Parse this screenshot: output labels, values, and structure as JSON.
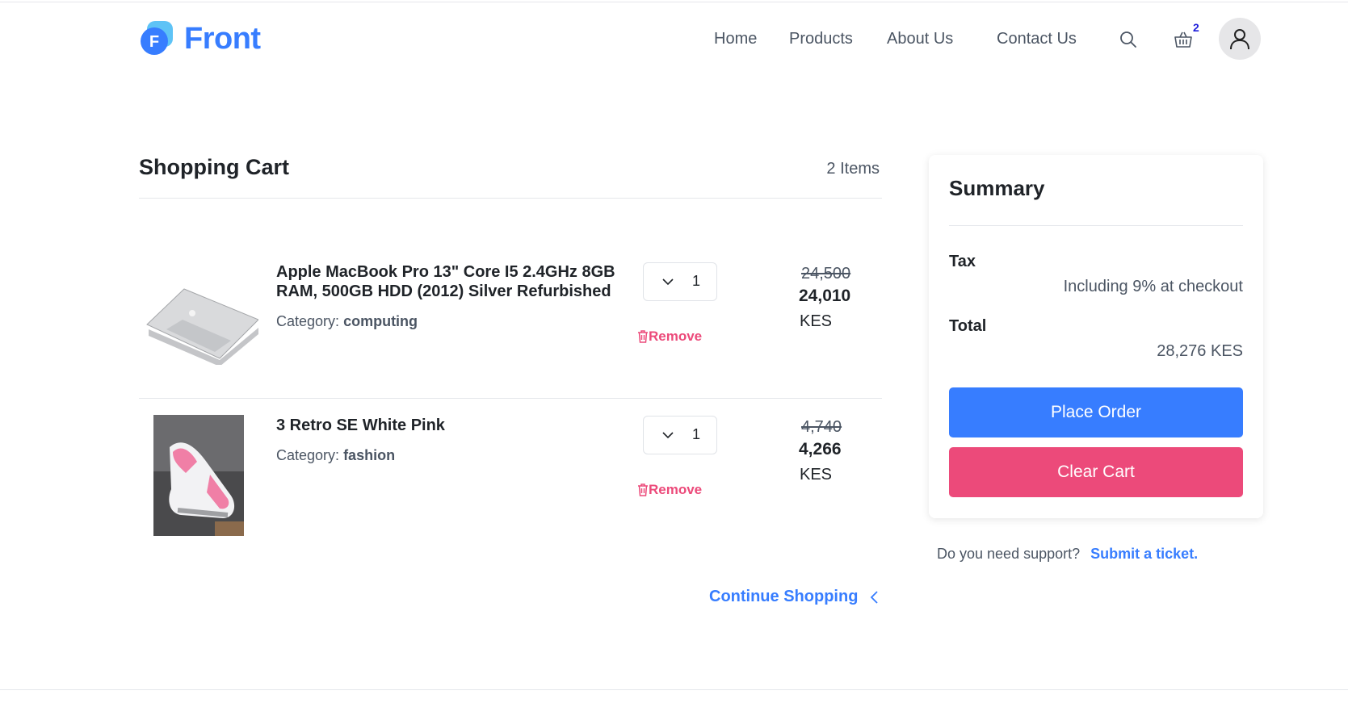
{
  "brand": {
    "name": "Front",
    "mark_letter": "F",
    "color": "#377dff"
  },
  "nav": {
    "links": [
      "Home",
      "Products",
      "About Us",
      "Contact Us"
    ],
    "cart_count": "2",
    "icons": [
      "search-icon",
      "basket-icon",
      "user-icon"
    ]
  },
  "cart": {
    "title": "Shopping Cart",
    "count_label": "2 Items",
    "items": [
      {
        "name": "Apple MacBook Pro 13\" Core I5 2.4GHz 8GB RAM, 500GB HDD (2012) Silver Refurbished",
        "category_label": "Category:",
        "category": "computing",
        "quantity": "1",
        "old_price": "24,500",
        "price": "24,010",
        "currency": "KES",
        "remove_label": "Remove"
      },
      {
        "name": "3 Retro SE White Pink",
        "category_label": "Category:",
        "category": "fashion",
        "quantity": "1",
        "old_price": "4,740",
        "price": "4,266",
        "currency": "KES",
        "remove_label": "Remove"
      }
    ],
    "continue_label": "Continue Shopping"
  },
  "summary": {
    "title": "Summary",
    "tax_label": "Tax",
    "tax_value": "Including 9% at checkout",
    "total_label": "Total",
    "total_value": "28,276 KES",
    "place_order_label": "Place Order",
    "clear_cart_label": "Clear Cart"
  },
  "support": {
    "question": "Do you need support?",
    "link_label": "Submit a ticket."
  },
  "colors": {
    "accent": "#377dff",
    "danger": "#ec4a7a",
    "text": "#1f2328",
    "muted": "#4b5563"
  }
}
